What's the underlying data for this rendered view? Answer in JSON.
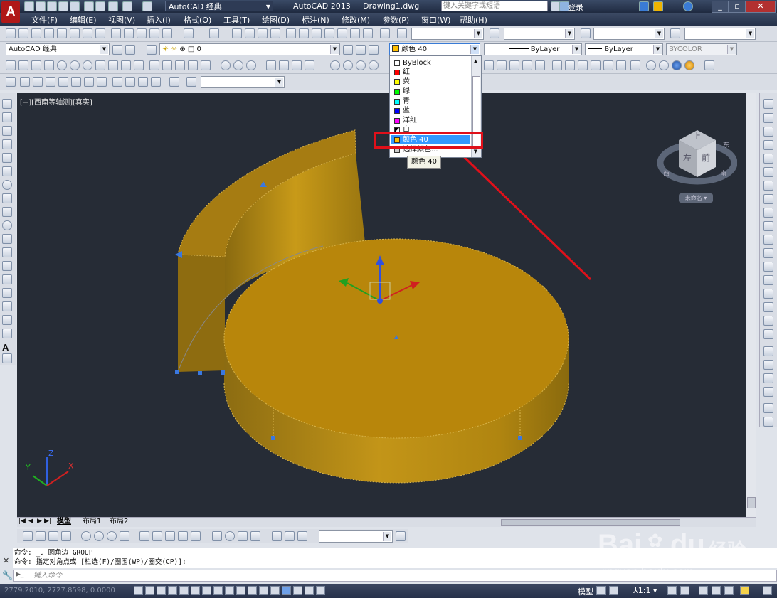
{
  "titlebar": {
    "logo": "A",
    "workspace": "AutoCAD 经典",
    "app_name": "AutoCAD 2013",
    "filename": "Drawing1.dwg",
    "search_placeholder": "键入关键字或短语",
    "login": "登录"
  },
  "menu": [
    "文件(F)",
    "编辑(E)",
    "视图(V)",
    "插入(I)",
    "格式(O)",
    "工具(T)",
    "绘图(D)",
    "标注(N)",
    "修改(M)",
    "参数(P)",
    "窗口(W)",
    "帮助(H)"
  ],
  "properties": {
    "workspace_combo": "AutoCAD 经典",
    "layer_value": "0",
    "color_value": "颜色 40",
    "linetype": "ByLayer",
    "lineweight": "ByLayer",
    "plotstyle": "BYCOLOR"
  },
  "color_dropdown": {
    "items": [
      {
        "label": "ByBlock",
        "color": "#ffffff"
      },
      {
        "label": "红",
        "color": "#ff0000"
      },
      {
        "label": "黄",
        "color": "#ffff00"
      },
      {
        "label": "绿",
        "color": "#00ff00"
      },
      {
        "label": "青",
        "color": "#00ffff"
      },
      {
        "label": "蓝",
        "color": "#0000ff"
      },
      {
        "label": "洋红",
        "color": "#ff00ff"
      },
      {
        "label": "白",
        "color": "#ffffff"
      },
      {
        "label": "颜色 40",
        "color": "#ffbf00",
        "selected": true
      },
      {
        "label": "选择颜色...",
        "color": "#cccccc"
      }
    ],
    "tooltip": "颜色 40",
    "highlight_color": "#e0101a"
  },
  "viewport": {
    "label": "[−][西南等轴测][真实]",
    "background": "#262c36",
    "object_color": "#b8860b"
  },
  "viewcube": {
    "top_label": "上",
    "left_label": "左",
    "front_label": "前",
    "compass_w": "西",
    "compass_s": "南",
    "compass_e": "东",
    "ucs_menu": "未命名"
  },
  "ucs_icon": {
    "x": "X",
    "y": "Y",
    "z": "Z"
  },
  "layout_tabs": [
    "模型",
    "布局1",
    "布局2"
  ],
  "command": {
    "history_line1": "命令: _u 圆角边 GROUP",
    "history_line2": "命令: 指定对角点或 [栏选(F)/圈围(WP)/圈交(CP)]:",
    "input_placeholder": "键入命令"
  },
  "statusbar": {
    "coords": "2779.2010, 2727.8598, 0.0000",
    "model": "模型",
    "scale": "1:1"
  },
  "watermark": {
    "brand": "Bai",
    "brand2": "du",
    "product": "经验",
    "url": "jingyan.baidu.com"
  }
}
